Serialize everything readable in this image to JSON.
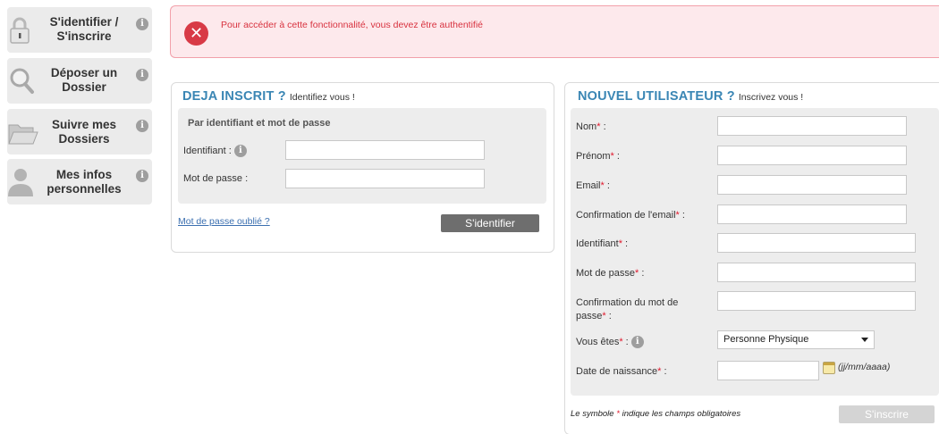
{
  "sidebar": {
    "items": [
      {
        "label_line1": "S'identifier /",
        "label_line2": "S'inscrire",
        "icon": "lock-icon"
      },
      {
        "label_line1": "Déposer un",
        "label_line2": "Dossier",
        "icon": "magnifier-icon"
      },
      {
        "label_line1": "Suivre mes",
        "label_line2": "Dossiers",
        "icon": "folder-icon"
      },
      {
        "label_line1": "Mes infos",
        "label_line2": "personnelles",
        "icon": "person-icon"
      }
    ],
    "info_glyph": "i"
  },
  "error": {
    "icon_glyph": "✕",
    "message": "Pour accéder à cette fonctionnalité, vous devez être authentifié"
  },
  "login": {
    "title": "DEJA INSCRIT ?",
    "subtitle": "Identifiez vous !",
    "section_title": "Par identifiant et mot de passe",
    "identifiant_label": "Identifiant :",
    "password_label": "Mot de passe :",
    "forgot_link": "Mot de passe oublié ?",
    "submit": "S'identifier"
  },
  "register": {
    "title": "NOUVEL UTILISATEUR ?",
    "subtitle": "Inscrivez vous !",
    "required_mark": "*",
    "fields": {
      "nom": "Nom",
      "prenom": "Prénom",
      "email": "Email",
      "email_confirm": "Confirmation de l'email",
      "identifiant": "Identifiant",
      "password": "Mot de passe",
      "password_confirm_line1": "Confirmation du mot de",
      "password_confirm_line2": "passe",
      "vous_etes": "Vous êtes",
      "birthdate": "Date de naissance"
    },
    "colon": " :",
    "vous_etes_value": "Personne Physique",
    "date_hint": "(jj/mm/aaaa)",
    "legend_before": "Le symbole ",
    "legend_after": " indique les champs obligatoires",
    "submit": "S'inscrire"
  }
}
